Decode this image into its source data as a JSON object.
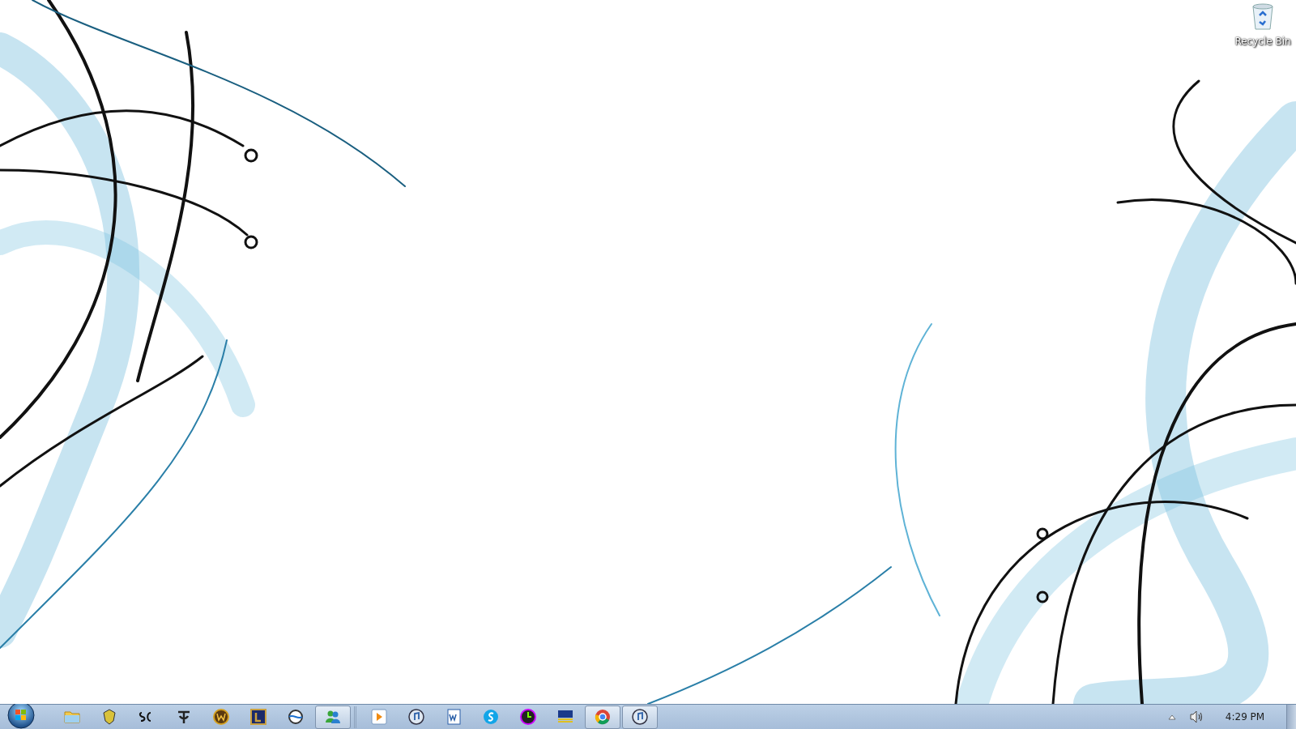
{
  "desktop": {
    "icons": [
      {
        "label": "Recycle Bin"
      }
    ]
  },
  "taskbar": {
    "groups": [
      {
        "buttons": [
          {
            "kind": "folder",
            "running": false
          },
          {
            "kind": "shield",
            "running": false
          },
          {
            "kind": "sc",
            "running": false
          },
          {
            "kind": "emblem",
            "running": false
          },
          {
            "kind": "w-disc",
            "running": false
          },
          {
            "kind": "l-square",
            "running": false
          },
          {
            "kind": "globe",
            "running": false
          },
          {
            "kind": "people",
            "running": true
          }
        ]
      },
      {
        "buttons": [
          {
            "kind": "play",
            "running": false
          },
          {
            "kind": "note",
            "running": false
          },
          {
            "kind": "doc",
            "running": false
          },
          {
            "kind": "s-cloud",
            "running": false
          },
          {
            "kind": "clock",
            "running": false
          },
          {
            "kind": "board",
            "running": false
          },
          {
            "kind": "chrome",
            "running": true
          },
          {
            "kind": "note",
            "running": true
          }
        ]
      }
    ],
    "tray": {
      "clock": "4:29 PM"
    }
  }
}
